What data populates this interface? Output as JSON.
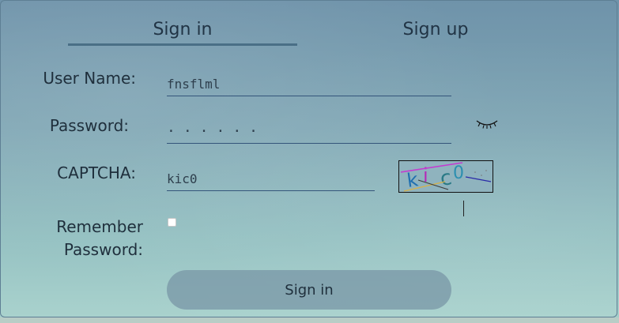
{
  "tabs": {
    "signin": "Sign in",
    "signup": "Sign up"
  },
  "form": {
    "username_label": "User Name:",
    "username_value": "fnsflml",
    "password_label": "Password:",
    "password_value": "······",
    "captcha_label": "CAPTCHA:",
    "captcha_value": "kic0",
    "captcha_image_text": "kic0",
    "remember_label": "Remember Password:",
    "remember_checked": false,
    "submit_label": "Sign in"
  },
  "icons": {
    "password_toggle": "eye-closed-icon"
  },
  "colors": {
    "tab_underline": "#4a6f86",
    "field_underline": "#34557a",
    "button_bg": "#7896a5"
  }
}
